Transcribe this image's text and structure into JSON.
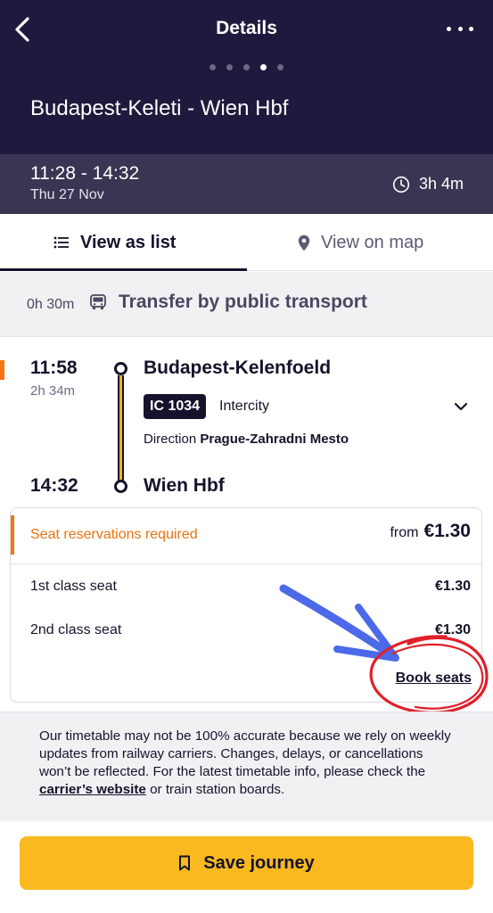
{
  "header": {
    "title": "Details",
    "route": "Budapest-Keleti - Wien Hbf",
    "page_dots": 5,
    "active_dot": 4
  },
  "trip": {
    "times": "11:28 - 14:32",
    "date": "Thu 27 Nov",
    "duration": "3h 4m"
  },
  "tabs": [
    {
      "label": "View as list",
      "icon": "list-icon",
      "active": true
    },
    {
      "label": "View on map",
      "icon": "map-pin-icon",
      "active": false
    }
  ],
  "transfer": {
    "duration": "0h 30m",
    "icon": "bus-icon",
    "label": "Transfer by public transport"
  },
  "leg": {
    "departure_time": "11:58",
    "leg_duration": "2h 34m",
    "departure_station": "Budapest-Kelenfoeld",
    "train_number": "IC 1034",
    "train_type": "Intercity",
    "direction_label": "Direction",
    "direction_value": "Prague-Zahradni Mesto",
    "arrival_time": "14:32",
    "arrival_station": "Wien Hbf"
  },
  "seats": {
    "warning": "Seat reservations required",
    "from_label": "from",
    "from_price": "€1.30",
    "rows": [
      {
        "label": "1st class seat",
        "price": "€1.30"
      },
      {
        "label": "2nd class seat",
        "price": "€1.30"
      }
    ],
    "book_label": "Book seats"
  },
  "disclaimer": {
    "text_before": "Our timetable may not be 100% accurate because we rely on weekly updates from railway carriers. Changes, delays, or cancellations won’t be reflected. For the latest timetable info, please check the ",
    "link": "carrier’s website",
    "text_after": " or train station boards."
  },
  "footer": {
    "save_label": "Save journey",
    "save_icon": "bookmark-icon"
  },
  "colors": {
    "header_bg": "#1f1a3d",
    "accent_yellow": "#f9b91f",
    "warning_orange": "#f7740f",
    "annotation_blue": "#4b69e8",
    "annotation_red": "#e0202a"
  }
}
